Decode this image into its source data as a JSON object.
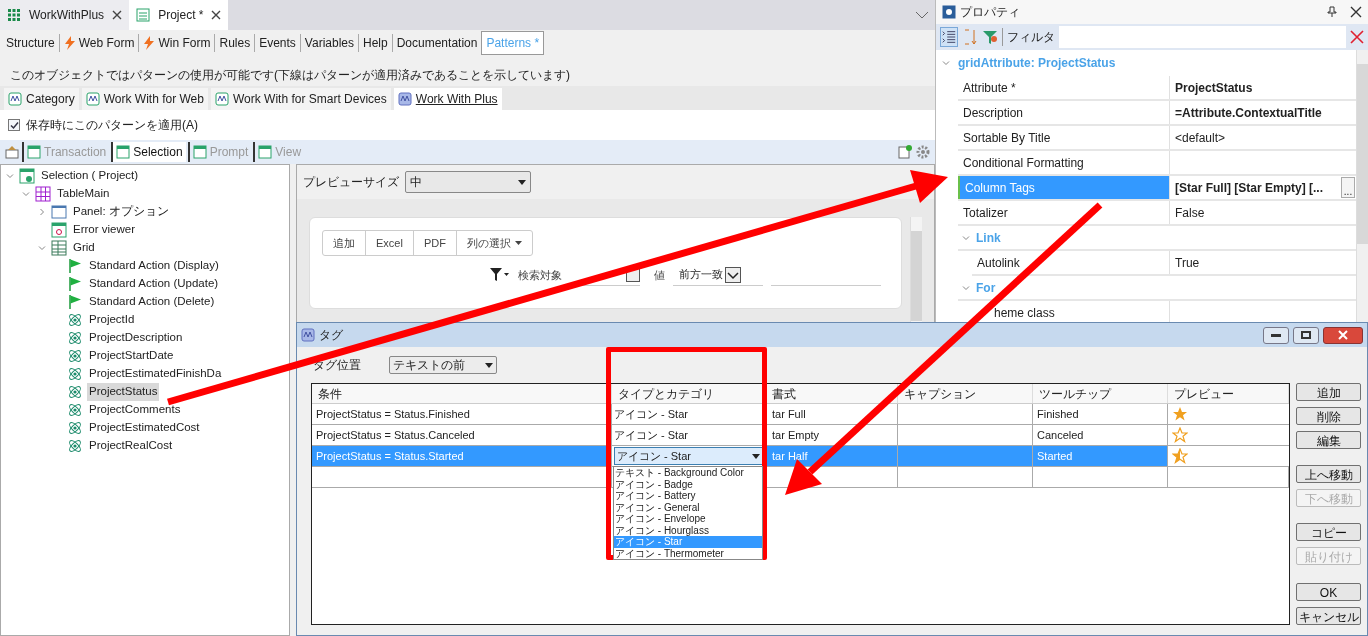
{
  "document_tabs": [
    {
      "label": "WorkWithPlus",
      "selected": false
    },
    {
      "label": "Project *",
      "selected": true
    }
  ],
  "object_tabs": [
    {
      "label": "Structure",
      "selected": false,
      "kind": "text"
    },
    {
      "label": "Web Form",
      "selected": false,
      "kind": "form"
    },
    {
      "label": "Win Form",
      "selected": false,
      "kind": "form"
    },
    {
      "label": "Rules",
      "selected": false,
      "kind": "text"
    },
    {
      "label": "Events",
      "selected": false,
      "kind": "text"
    },
    {
      "label": "Variables",
      "selected": false,
      "kind": "text"
    },
    {
      "label": "Help",
      "selected": false,
      "kind": "text"
    },
    {
      "label": "Documentation",
      "selected": false,
      "kind": "text"
    },
    {
      "label": "Patterns *",
      "selected": true,
      "kind": "text"
    }
  ],
  "pattern_info": "このオブジェクトではパターンの使用が可能です(下線はパターンが適用済みであることを示しています)",
  "pattern_tabs": [
    {
      "label": "Category",
      "selected": false,
      "applied": false
    },
    {
      "label": "Work With for Web",
      "selected": false,
      "applied": false
    },
    {
      "label": "Work With for Smart Devices",
      "selected": false,
      "applied": false
    },
    {
      "label": "Work With Plus",
      "selected": true,
      "applied": true
    }
  ],
  "apply_on_save": {
    "label": "保存時にこのパターンを適用(A)",
    "checked": true
  },
  "instance_tabs": [
    {
      "label": "Transaction",
      "selected": false
    },
    {
      "label": "Selection",
      "selected": true
    },
    {
      "label": "Prompt",
      "selected": false
    },
    {
      "label": "View",
      "selected": false
    }
  ],
  "tree": [
    {
      "label": "Selection ( Project)",
      "kind": "selection",
      "selected": false,
      "expanded": true,
      "children": [
        {
          "label": "TableMain",
          "kind": "table",
          "selected": false,
          "expanded": true,
          "children": [
            {
              "label": "Panel: オプション",
              "kind": "panel",
              "selected": false,
              "expanded": false
            },
            {
              "label": "Error viewer",
              "kind": "error",
              "selected": false
            },
            {
              "label": "Grid",
              "kind": "grid",
              "selected": false,
              "expanded": true,
              "children": [
                {
                  "label": "Standard Action (Display)",
                  "kind": "action",
                  "selected": false
                },
                {
                  "label": "Standard Action (Update)",
                  "kind": "action",
                  "selected": false
                },
                {
                  "label": "Standard Action (Delete)",
                  "kind": "action",
                  "selected": false
                },
                {
                  "label": "ProjectId",
                  "kind": "attribute",
                  "selected": false
                },
                {
                  "label": "ProjectDescription",
                  "kind": "attribute",
                  "selected": false
                },
                {
                  "label": "ProjectStartDate",
                  "kind": "attribute",
                  "selected": false
                },
                {
                  "label": "ProjectEstimatedFinishDa",
                  "kind": "attribute",
                  "selected": false
                },
                {
                  "label": "ProjectStatus",
                  "kind": "attribute",
                  "selected": true
                },
                {
                  "label": "ProjectComments",
                  "kind": "attribute",
                  "selected": false
                },
                {
                  "label": "ProjectEstimatedCost",
                  "kind": "attribute",
                  "selected": false
                },
                {
                  "label": "ProjectRealCost",
                  "kind": "attribute",
                  "selected": false
                }
              ]
            }
          ]
        }
      ]
    }
  ],
  "preview": {
    "size_label": "プレビューサイズ",
    "size_value": "中",
    "buttons": [
      "追加",
      "Excel",
      "PDF",
      "列の選択"
    ],
    "search_label": "検索対象",
    "value_label": "値",
    "match_value": "前方一致"
  },
  "properties": {
    "title": "プロパティ",
    "filter_label": "フィルタ",
    "section": "gridAttribute: ProjectStatus",
    "items": [
      {
        "kind": "row",
        "name": "Attribute *",
        "value": "ProjectStatus",
        "bold": true,
        "selected": false
      },
      {
        "kind": "row",
        "name": "Description",
        "value": "=Attribute.ContextualTitle",
        "bold": true,
        "selected": false
      },
      {
        "kind": "row",
        "name": "Sortable By Title",
        "value": "<default>",
        "bold": false,
        "selected": false
      },
      {
        "kind": "row",
        "name": "Conditional Formatting",
        "selected": false
      },
      {
        "kind": "row",
        "name": "Column Tags",
        "value": "[Star Full] [Star Empty] [...",
        "bold": true,
        "selected": true,
        "button": "..."
      },
      {
        "kind": "row",
        "name": "Totalizer",
        "value": "False",
        "bold": false,
        "selected": false
      },
      {
        "kind": "group",
        "name": "Link",
        "expanded": true,
        "children": [
          {
            "kind": "row",
            "name": "Autolink",
            "value": "True",
            "bold": false,
            "selected": false
          }
        ]
      },
      {
        "kind": "group",
        "name": "For",
        "expanded": true,
        "children": [
          {
            "kind": "row",
            "name": "heme class",
            "selected": false
          }
        ]
      }
    ]
  },
  "dialog": {
    "title": "タグ",
    "position_label": "タグ位置",
    "position_value": "テキストの前",
    "columns": [
      "条件",
      "タイプとカテゴリ",
      "書式",
      "キャプション",
      "ツールチップ",
      "プレビュー"
    ],
    "rows": [
      {
        "condition": "ProjectStatus = Status.Finished",
        "type": "アイコン - Star",
        "format": "tar Full",
        "tooltip": "Finished",
        "kind": "full",
        "selected": false
      },
      {
        "condition": "ProjectStatus = Status.Canceled",
        "type": "アイコン - Star",
        "format": "tar Empty",
        "tooltip": "Canceled",
        "kind": "empty",
        "selected": false
      },
      {
        "condition": "ProjectStatus = Status.Started",
        "type": "アイコン - Star",
        "format": "tar Half",
        "tooltip": "Started",
        "kind": "half",
        "selected": true
      }
    ],
    "dropdown_options": [
      {
        "label": "テキスト - Background Color",
        "selected": false
      },
      {
        "label": "アイコン - Badge",
        "selected": false
      },
      {
        "label": "アイコン - Battery",
        "selected": false
      },
      {
        "label": "アイコン - General",
        "selected": false
      },
      {
        "label": "アイコン - Envelope",
        "selected": false
      },
      {
        "label": "アイコン - Hourglass",
        "selected": false
      },
      {
        "label": "アイコン - Star",
        "selected": true
      },
      {
        "label": "アイコン - Thermometer",
        "selected": false
      }
    ],
    "button_groups": [
      [
        {
          "label": "追加",
          "disabled": false
        },
        {
          "label": "削除",
          "disabled": false
        },
        {
          "label": "編集",
          "disabled": false
        }
      ],
      [
        {
          "label": "上へ移動",
          "disabled": false
        },
        {
          "label": "下へ移動",
          "disabled": true
        }
      ],
      [
        {
          "label": "コピー",
          "disabled": false
        },
        {
          "label": "貼り付け",
          "disabled": true
        }
      ],
      [
        {
          "label": "OK",
          "disabled": false
        },
        {
          "label": "キャンセル",
          "disabled": false
        }
      ]
    ]
  }
}
